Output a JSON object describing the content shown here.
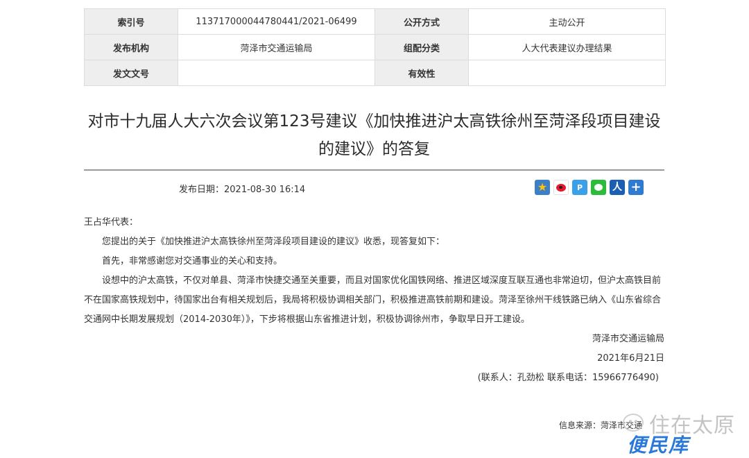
{
  "meta": {
    "rows": [
      {
        "k1": "索引号",
        "v1": "113717000044780441/2021-06499",
        "k2": "公开方式",
        "v2": "主动公开"
      },
      {
        "k1": "发布机构",
        "v1": "菏泽市交通运输局",
        "k2": "组配分类",
        "v2": "人大代表建议办理结果"
      },
      {
        "k1": "发文文号",
        "v1": "",
        "k2": "有效性",
        "v2": ""
      }
    ]
  },
  "article": {
    "title_line1": "对市十九届人大六次会议第123号建议《加快推进沪太高铁徐州至菏泽段项目建设",
    "title_line2": "的建议》的答复",
    "pub_date": "发布日期：2021-08-30 16:14",
    "salutation": "王占华代表：",
    "para1": "您提出的关于《加快推进沪太高铁徐州至菏泽段项目建设的建议》收悉，现答复如下：",
    "para2": "首先，非常感谢您对交通事业的关心和支持。",
    "para3": "设想中的沪太高铁，不仅对单县、菏泽市快捷交通至关重要，而且对国家优化国铁网络、推进区域深度互联互通也非常迫切，但沪太高铁目前不在国家高铁规划中，待国家出台有相关规划后，我局将积极协调相关部门，积极推进高铁前期和建设。菏泽至徐州干线铁路已纳入《山东省综合交通网中长期发展规划（2014-2030年）》，下步将根据山东省推进计划，积极协调徐州市，争取早日开工建设。",
    "signature": "菏泽市交通运输局",
    "sign_date": "2021年6月21日",
    "contact": "(联系人：孔劲松  联系电话：15966776490)",
    "source": "信息来源：菏泽市交通"
  },
  "share": {
    "icons": [
      "favorite-icon",
      "weibo-icon",
      "qzone-icon",
      "wechat-icon",
      "renren-icon",
      "more-share-icon"
    ],
    "fav_glyph": "★",
    "qzone_glyph": "P",
    "renren_glyph": "人",
    "more_glyph": "+"
  },
  "watermark": {
    "line1": "住在太原",
    "line2": "便民库"
  },
  "colors": {
    "label_bg": "#eeeeee",
    "border": "#dcdcdc",
    "watermark_blue": "#2a78d8"
  }
}
